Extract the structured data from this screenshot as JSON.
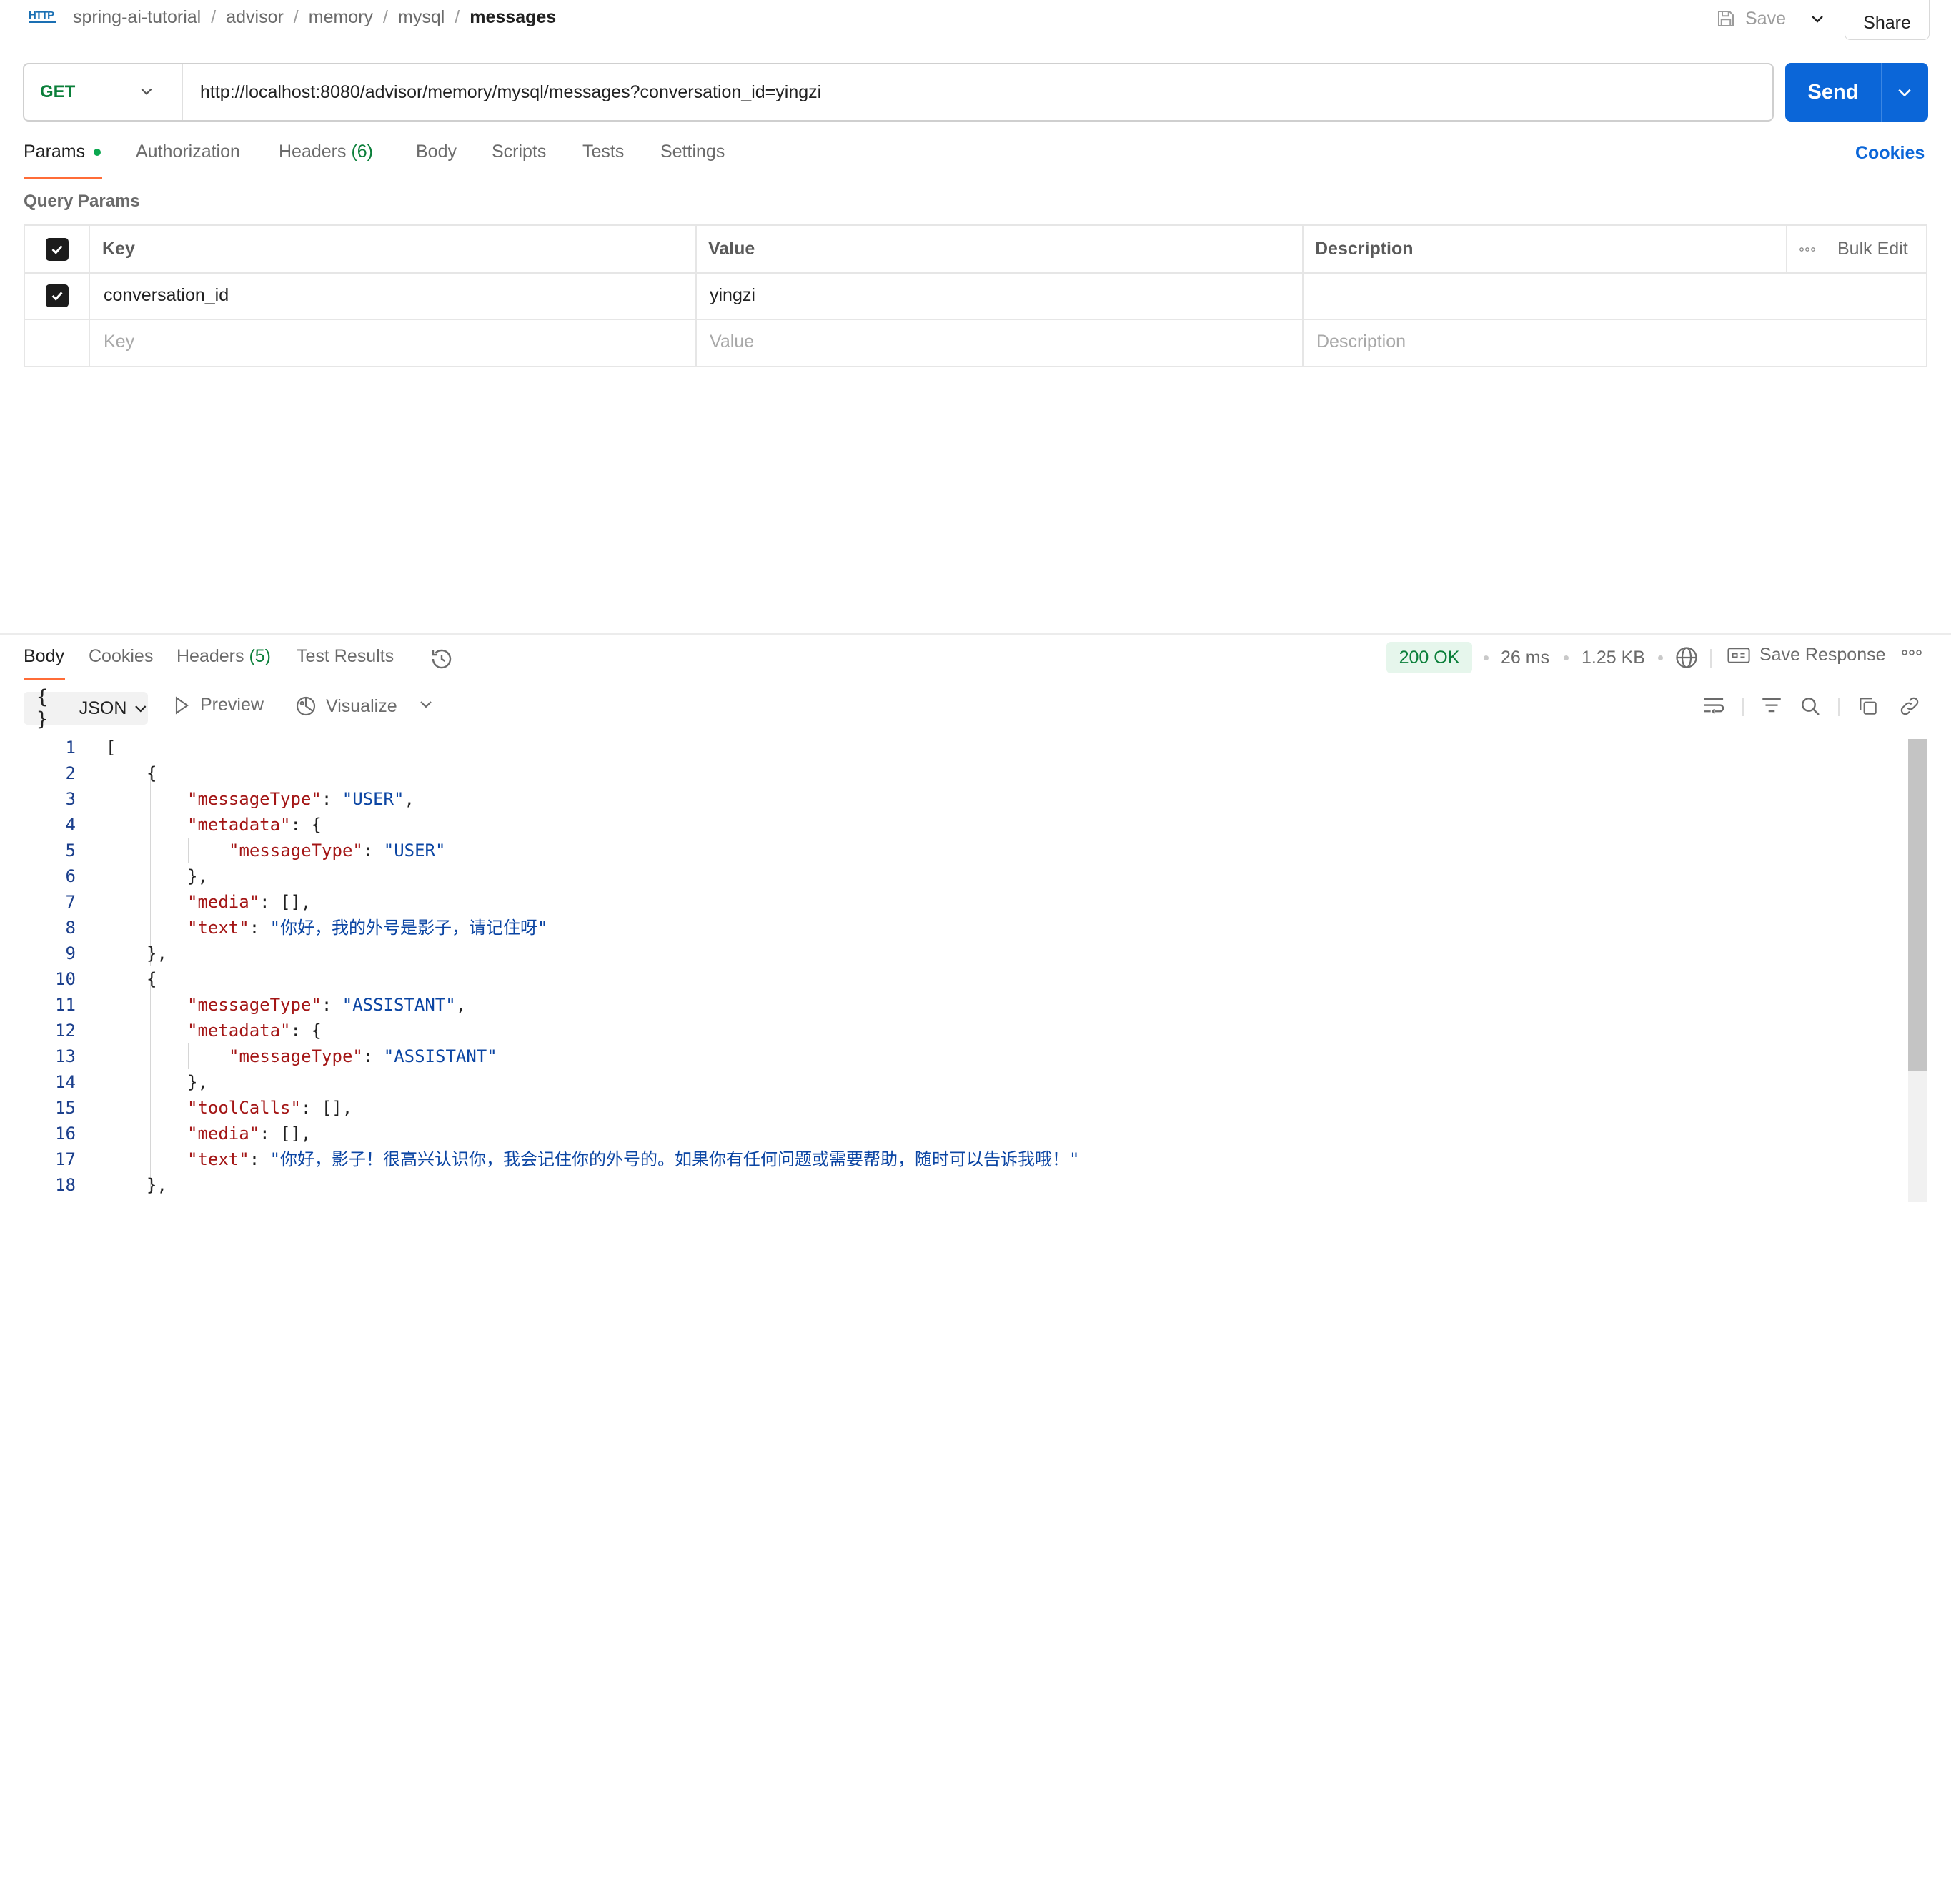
{
  "header": {
    "http_badge": "HTTP",
    "breadcrumb": [
      "spring-ai-tutorial",
      "advisor",
      "memory",
      "mysql"
    ],
    "breadcrumb_sep": "/",
    "current": "messages",
    "save_label": "Save",
    "share_label": "Share"
  },
  "request": {
    "method": "GET",
    "url": "http://localhost:8080/advisor/memory/mysql/messages?conversation_id=yingzi",
    "send_label": "Send"
  },
  "request_tabs": {
    "params": "Params",
    "authorization": "Authorization",
    "headers": "Headers",
    "headers_count": "(6)",
    "body": "Body",
    "scripts": "Scripts",
    "tests": "Tests",
    "settings": "Settings",
    "cookies": "Cookies"
  },
  "query_params": {
    "title": "Query Params",
    "columns": {
      "key": "Key",
      "value": "Value",
      "description": "Description",
      "bulk_edit": "Bulk Edit"
    },
    "rows": [
      {
        "key": "conversation_id",
        "value": "yingzi",
        "description": ""
      }
    ],
    "placeholders": {
      "key": "Key",
      "value": "Value",
      "description": "Description"
    }
  },
  "response_tabs": {
    "body": "Body",
    "cookies": "Cookies",
    "headers": "Headers",
    "headers_count": "(5)",
    "test_results": "Test Results"
  },
  "response_meta": {
    "status": "200 OK",
    "time": "26 ms",
    "size": "1.25 KB",
    "save_response": "Save Response"
  },
  "response_toolbar": {
    "format": "JSON",
    "preview": "Preview",
    "visualize": "Visualize"
  },
  "code": {
    "line_numbers": [
      "1",
      "2",
      "3",
      "4",
      "5",
      "6",
      "7",
      "8",
      "9",
      "10",
      "11",
      "12",
      "13",
      "14",
      "15",
      "16",
      "17",
      "18"
    ],
    "lines": [
      "[",
      "{",
      "\"messageType\": \"USER\",",
      "\"metadata\": {",
      "\"messageType\": \"USER\"",
      "},",
      "\"media\": [],",
      "\"text\": \"你好，我的外号是影子，请记住呀\"",
      "},",
      "{",
      "\"messageType\": \"ASSISTANT\",",
      "\"metadata\": {",
      "\"messageType\": \"ASSISTANT\"",
      "},",
      "\"toolCalls\": [],",
      "\"media\": [],",
      "\"text\": \"你好，影子！很高兴认识你，我会记住你的外号的。如果你有任何问题或需要帮助，随时可以告诉我哦！\"",
      "},"
    ]
  },
  "colors": {
    "accent_orange": "#ff6c37",
    "send_blue": "#0b66d8",
    "method_green": "#0b7f3a",
    "json_key": "#a31515",
    "json_string": "#0b45a3"
  }
}
